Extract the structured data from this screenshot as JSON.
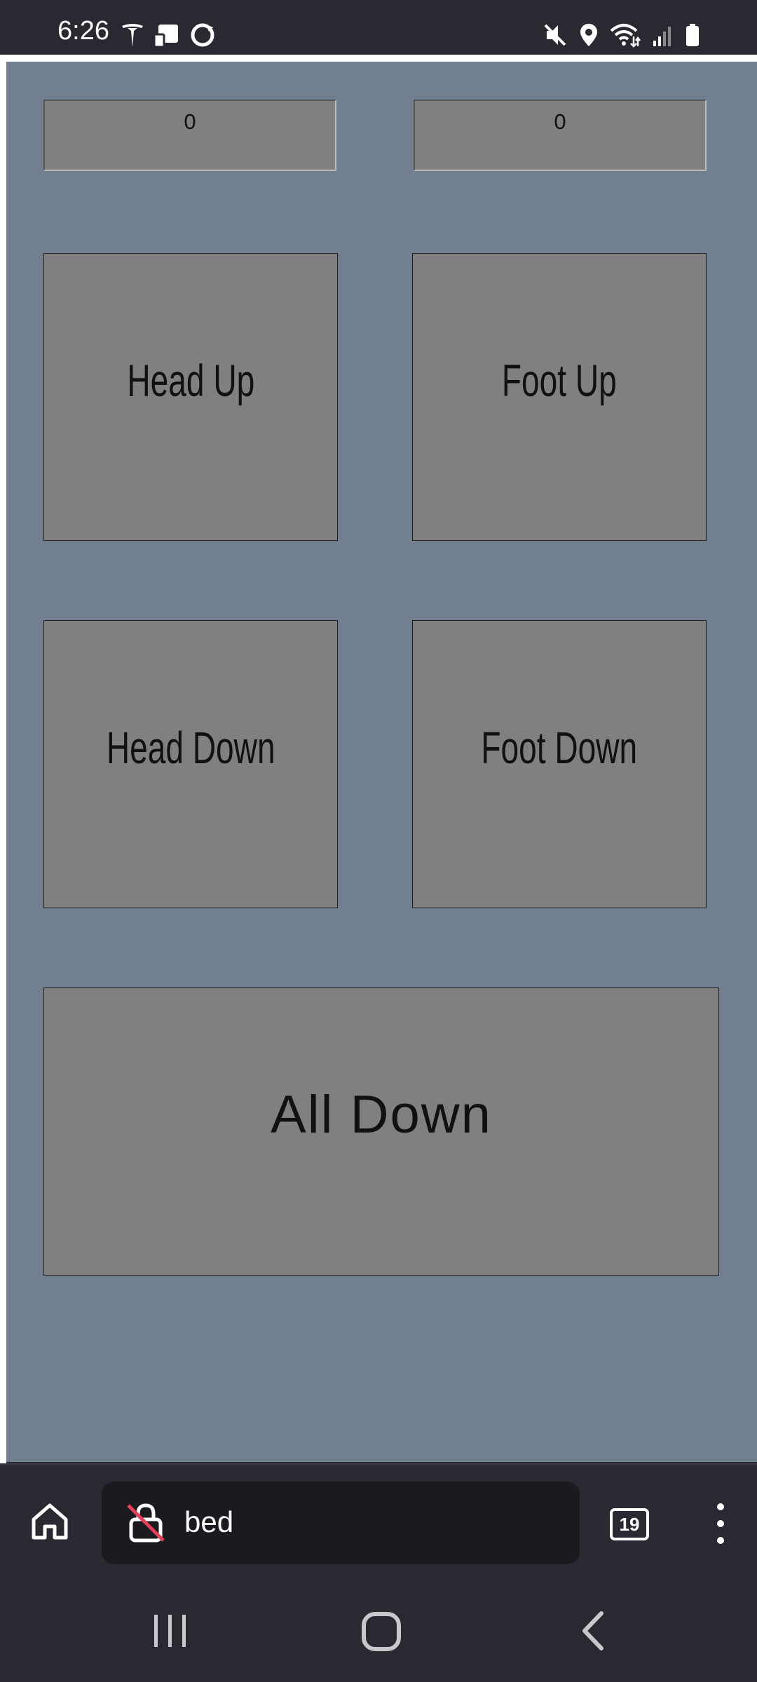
{
  "status_bar": {
    "time": "6:26",
    "left_icons": [
      "tesla-icon",
      "cast-icon",
      "circle-notification-icon"
    ],
    "right_icons": [
      "mute-icon",
      "location-icon",
      "wifi-icon",
      "signal-icon",
      "battery-icon"
    ]
  },
  "page": {
    "background": "#717f90",
    "counters": [
      "0",
      "0"
    ],
    "buttons": {
      "head_up": "Head Up",
      "foot_up": "Foot Up",
      "head_down": "Head Down",
      "foot_down": "Foot Down",
      "all_down": "All Down"
    },
    "button_color": "#808080"
  },
  "browser": {
    "url": "bed",
    "tab_count": "19",
    "icons": [
      "home-icon",
      "insecure-lock-icon",
      "tabs-icon",
      "more-vert-icon"
    ]
  },
  "nav_bar": {
    "icons": [
      "recent-apps-icon",
      "home-icon",
      "back-icon"
    ]
  }
}
